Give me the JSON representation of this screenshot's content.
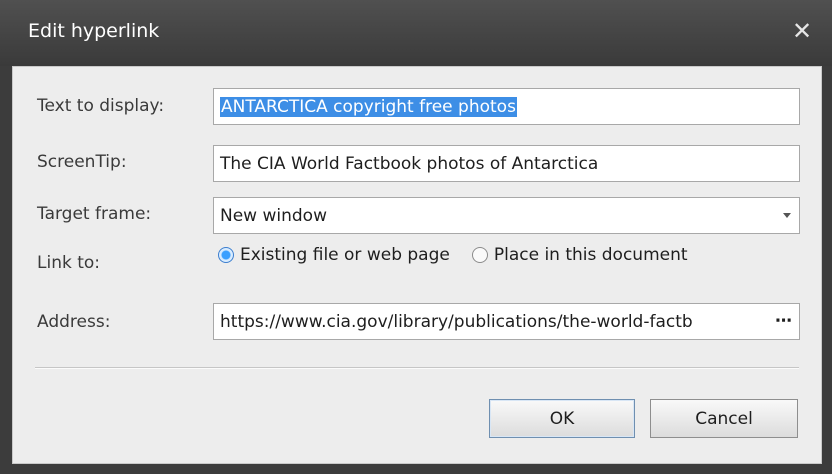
{
  "window": {
    "title": "Edit hyperlink",
    "close_icon": "close-icon"
  },
  "fields": {
    "text_to_display_label": "Text to display:",
    "text_to_display_value": "ANTARCTICA copyright free photos",
    "screentip_label": "ScreenTip:",
    "screentip_value": "The CIA World Factbook photos of Antarctica",
    "target_frame_label": "Target frame:",
    "target_frame_value": "New window",
    "link_to_label": "Link to:",
    "address_label": "Address:",
    "address_value": "https://www.cia.gov/library/publications/the-world-factb",
    "address_more": "⋯"
  },
  "link_to": {
    "options": [
      "Existing file or web page",
      "Place in this document"
    ],
    "selected": "Existing file or web page"
  },
  "buttons": {
    "ok": "OK",
    "cancel": "Cancel"
  },
  "colors": {
    "selection": "#3d8ee6",
    "titlebar": "#3c3c3c",
    "client": "#ededed"
  }
}
